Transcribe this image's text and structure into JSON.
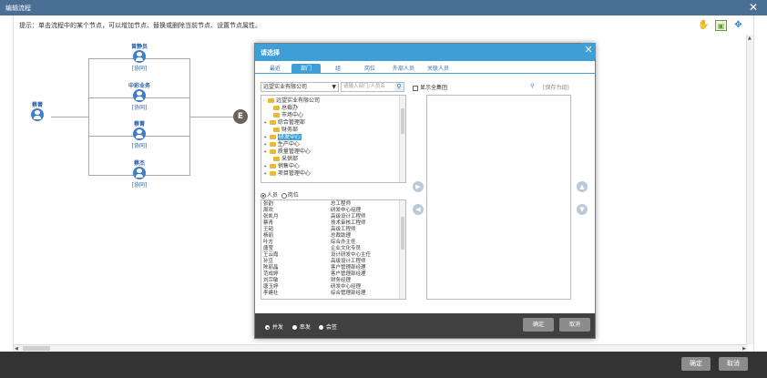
{
  "window": {
    "title": "编辑流程"
  },
  "hint": "提示：单击流程中的某个节点，可以增加节点、替换或删除当前节点、设置节点属性。",
  "toolbar": {
    "hand_icon": "hand-icon",
    "box_icon": "display-icon",
    "fit_icon": "fit-view-icon"
  },
  "flow": {
    "start": {
      "name": "蔡菁"
    },
    "branches": [
      {
        "name": "曾静员",
        "type": "[协同]"
      },
      {
        "name": "中彩业务",
        "type": "[协同]"
      },
      {
        "name": "蔡菁",
        "type": "[协同]"
      },
      {
        "name": "蔡杰",
        "type": "[协同]"
      }
    ],
    "end": {
      "label": "E"
    }
  },
  "footer": {
    "ok": "确定",
    "cancel": "取消"
  },
  "dialog": {
    "title": "请选择",
    "tabs": [
      "最近",
      "部门",
      "组",
      "岗位",
      "外部人员",
      "关联人员"
    ],
    "active_tab": 1,
    "unit": "远望实业有限公司",
    "search_placeholder": "请输入部门/人员名",
    "tree": [
      {
        "label": "远望实业有限公司",
        "level": 0,
        "pm": "-"
      },
      {
        "label": "总裁办",
        "level": 1,
        "pm": ""
      },
      {
        "label": "市场中心",
        "level": 1,
        "pm": ""
      },
      {
        "label": "综合管理部",
        "level": 1,
        "pm": "+"
      },
      {
        "label": "财务部",
        "level": 1,
        "pm": ""
      },
      {
        "label": "研发中心",
        "level": 1,
        "pm": "+",
        "selected": true
      },
      {
        "label": "生产中心",
        "level": 1,
        "pm": "+"
      },
      {
        "label": "质量管理中心",
        "level": 1,
        "pm": "+"
      },
      {
        "label": "采供部",
        "level": 1,
        "pm": ""
      },
      {
        "label": "销售中心",
        "level": 1,
        "pm": "+"
      },
      {
        "label": "项目管理中心",
        "level": 1,
        "pm": "+"
      }
    ],
    "mode_options": [
      "人员",
      "岗位"
    ],
    "people": [
      {
        "name": "张韵",
        "post": "总工程师"
      },
      {
        "name": "周欢",
        "post": "研发中心经理"
      },
      {
        "name": "张凯月",
        "post": "高级设计工程师"
      },
      {
        "name": "蔡青",
        "post": "技术审核工程师"
      },
      {
        "name": "王韬",
        "post": "高级工程师"
      },
      {
        "name": "杨丽",
        "post": "总裁助理"
      },
      {
        "name": "叶方",
        "post": "综合办主任"
      },
      {
        "name": "唐莹",
        "post": "企业文化专员"
      },
      {
        "name": "王云霞",
        "post": "设计研发中心主任"
      },
      {
        "name": "孙豆",
        "post": "高级设计工程师"
      },
      {
        "name": "陈丽晶",
        "post": "客户管理部经理"
      },
      {
        "name": "范成婷",
        "post": "客户管理部经理"
      },
      {
        "name": "刘宗敏",
        "post": "财务经理"
      },
      {
        "name": "唐玉婷",
        "post": "研发中心经理"
      },
      {
        "name": "李建社",
        "post": "综合管理部经理"
      }
    ],
    "all_group": "显示全集团",
    "save_group": "[保存为组]",
    "options": [
      "并发",
      "串发",
      "会签"
    ],
    "ok": "确定",
    "cancel": "取消"
  }
}
